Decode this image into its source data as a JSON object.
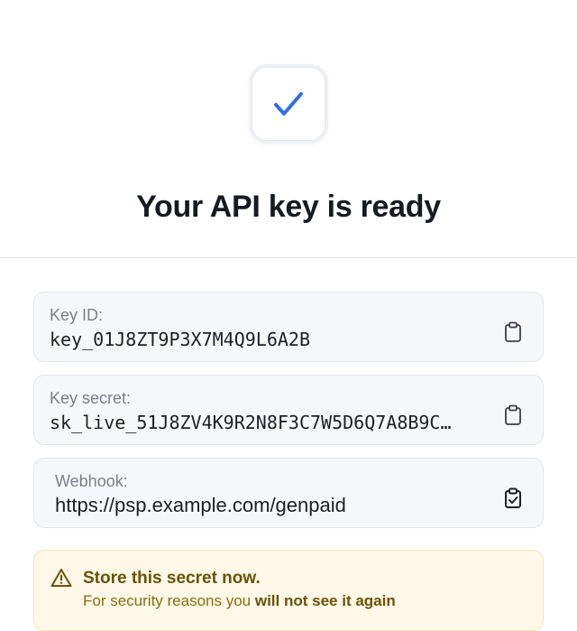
{
  "header": {
    "icon": "checkmark-icon",
    "accent_color": "#2f6fe6",
    "title": "Your API key is ready"
  },
  "fields": [
    {
      "label": "Key ID:",
      "value": "key_01J8ZT9P3X7M4Q9L6A2B",
      "action_icon": "clipboard-icon"
    },
    {
      "label": "Key secret:",
      "value": "sk_live_51J8ZV4K9R2N8F3C7W5D6Q7A8B9C…",
      "action_icon": "clipboard-icon"
    },
    {
      "label": "Webhook:",
      "value": "https://psp.example.com/genpaid",
      "action_icon": "clipboard-check-icon"
    }
  ],
  "warning": {
    "icon": "warning-triangle-icon",
    "title": "Store this secret now.",
    "body_prefix": "For security reasons you ",
    "body_emphasis": "will not see it again",
    "color": "#6b5206"
  }
}
